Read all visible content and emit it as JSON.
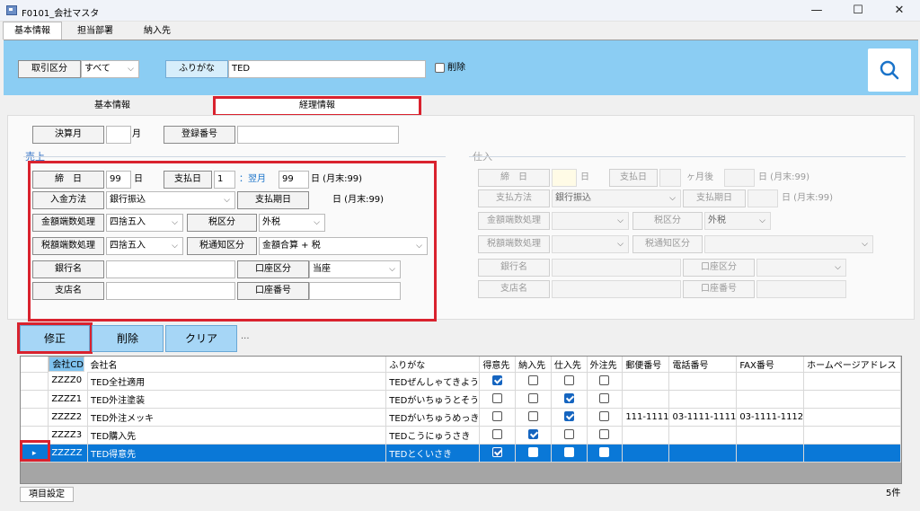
{
  "window": {
    "title": "F0101_会社マスタ",
    "minimize": "—",
    "maximize": "☐",
    "close": "✕"
  },
  "tabs": [
    "基本情報",
    "担当部署",
    "納入先"
  ],
  "search": {
    "kubun_label": "取引区分",
    "kubun_value": "すべて",
    "furigana_label": "ふりがな",
    "furigana_value": "TED",
    "delete_label": "削除"
  },
  "subtabs": {
    "basic": "基本情報",
    "accounting": "経理情報"
  },
  "settle": {
    "month_label": "決算月",
    "month_value": "",
    "month_unit": "月",
    "reg_label": "登録番号",
    "reg_value": ""
  },
  "sales": {
    "title": "売上",
    "close_label": "締　日",
    "close_value": "99",
    "day_unit": "日",
    "pay_label": "支払日",
    "pay_value": "1",
    "pay_month": "：翌月",
    "pay_day": "99",
    "pay_note": "日 (月末:99)",
    "method_label": "入金方法",
    "method_value": "銀行振込",
    "due_label": "支払期日",
    "due_note": "日 (月末:99)",
    "round_label": "金額端数処理",
    "round_value": "四捨五入",
    "tax_label": "税区分",
    "tax_value": "外税",
    "taxround_label": "税額端数処理",
    "taxround_value": "四捨五入",
    "taxnotice_label": "税通知区分",
    "taxnotice_value": "金額合算 + 税",
    "bank_label": "銀行名",
    "bank_value": "",
    "account_type_label": "口座区分",
    "account_type_value": "当座",
    "branch_label": "支店名",
    "branch_value": "",
    "account_no_label": "口座番号",
    "account_no_value": ""
  },
  "purchase": {
    "title": "仕入",
    "close_label": "締　日",
    "day_unit": "日",
    "pay_label": "支払日",
    "pay_month": "ヶ月後",
    "pay_note": "日 (月末:99)",
    "method_label": "支払方法",
    "method_value": "銀行振込",
    "due_label": "支払期日",
    "due_note": "日 (月末:99)",
    "round_label": "金額端数処理",
    "tax_label": "税区分",
    "tax_value": "外税",
    "taxround_label": "税額端数処理",
    "taxnotice_label": "税通知区分",
    "bank_label": "銀行名",
    "account_type_label": "口座区分",
    "branch_label": "支店名",
    "account_no_label": "口座番号"
  },
  "actions": {
    "edit": "修正",
    "delete": "削除",
    "clear": "クリア",
    "more": "..."
  },
  "grid": {
    "columns": [
      "会社CD",
      "会社名",
      "ふりがな",
      "得意先",
      "納入先",
      "仕入先",
      "外注先",
      "郵便番号",
      "電話番号",
      "FAX番号",
      "ホームページアドレス"
    ],
    "rows": [
      {
        "cd": "ZZZZ0",
        "name": "TED全社適用",
        "kana": "TEDぜんしゃてきよう",
        "c": [
          true,
          false,
          false,
          false
        ],
        "zip": "",
        "tel": "",
        "fax": "",
        "url": ""
      },
      {
        "cd": "ZZZZ1",
        "name": "TED外注塗装",
        "kana": "TEDがいちゅうとそう",
        "c": [
          false,
          false,
          true,
          false
        ],
        "zip": "",
        "tel": "",
        "fax": "",
        "url": ""
      },
      {
        "cd": "ZZZZ2",
        "name": "TED外注メッキ",
        "kana": "TEDがいちゅうめっき",
        "c": [
          false,
          false,
          true,
          false
        ],
        "zip": "111-1111",
        "tel": "03-1111-1111",
        "fax": "03-1111-1112",
        "url": ""
      },
      {
        "cd": "ZZZZ3",
        "name": "TED購入先",
        "kana": "TEDこうにゅうさき",
        "c": [
          false,
          true,
          false,
          false
        ],
        "zip": "",
        "tel": "",
        "fax": "",
        "url": ""
      },
      {
        "cd": "ZZZZZ",
        "name": "TED得意先",
        "kana": "TEDとくいさき",
        "c": [
          true,
          false,
          false,
          false
        ],
        "zip": "",
        "tel": "",
        "fax": "",
        "url": ""
      }
    ]
  },
  "footer": {
    "settings": "項目設定",
    "count": "5件"
  },
  "colors": {
    "accent": "#8bcdf3",
    "highlight": "#d9222e",
    "selected_row": "#0a78d7"
  },
  "icons": {
    "search": "search-icon",
    "app": "app-icon",
    "row_pointer": "row-pointer-icon"
  }
}
